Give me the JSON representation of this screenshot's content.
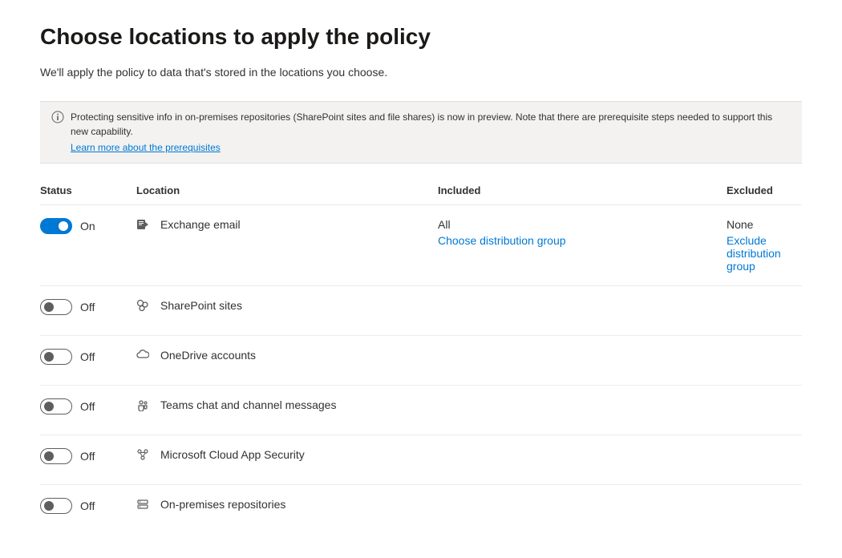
{
  "title": "Choose locations to apply the policy",
  "subtitle": "We'll apply the policy to data that's stored in the locations you choose.",
  "info": {
    "text": "Protecting sensitive info in on-premises repositories (SharePoint sites and file shares) is now in preview. Note that there are prerequisite steps needed to support this new capability.",
    "link_label": "Learn more about the prerequisites"
  },
  "headers": {
    "status": "Status",
    "location": "Location",
    "included": "Included",
    "excluded": "Excluded"
  },
  "toggle_labels": {
    "on": "On",
    "off": "Off"
  },
  "rows": [
    {
      "on": true,
      "icon": "exchange-icon",
      "name": "Exchange email",
      "included_value": "All",
      "included_action": "Choose distribution group",
      "excluded_value": "None",
      "excluded_action": "Exclude distribution group"
    },
    {
      "on": false,
      "icon": "sharepoint-icon",
      "name": "SharePoint sites"
    },
    {
      "on": false,
      "icon": "onedrive-icon",
      "name": "OneDrive accounts"
    },
    {
      "on": false,
      "icon": "teams-icon",
      "name": "Teams chat and channel messages"
    },
    {
      "on": false,
      "icon": "mcas-icon",
      "name": "Microsoft Cloud App Security"
    },
    {
      "on": false,
      "icon": "onprem-icon",
      "name": "On-premises repositories"
    }
  ]
}
